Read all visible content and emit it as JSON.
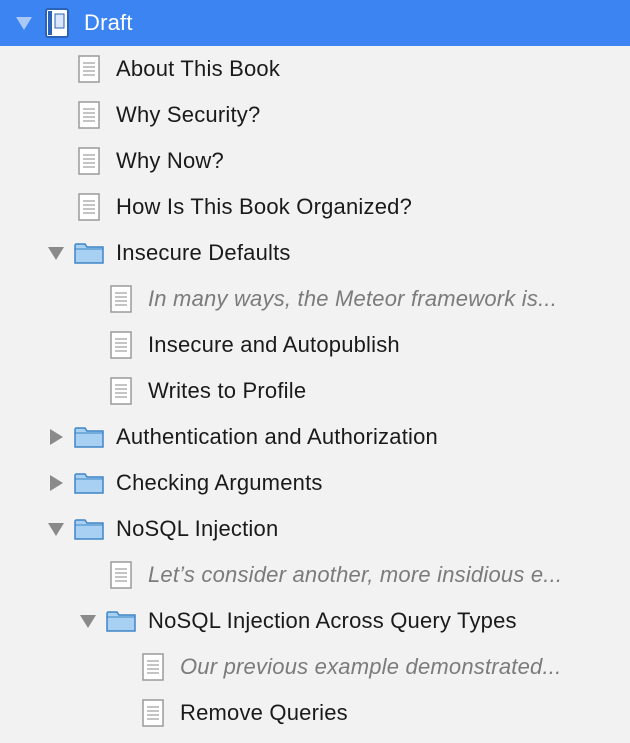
{
  "binder": {
    "items": [
      {
        "label": "Draft",
        "type": "book",
        "expanded": true,
        "selected": true,
        "italic": false
      },
      {
        "label": "About This Book",
        "type": "doc",
        "italic": false
      },
      {
        "label": "Why Security?",
        "type": "doc",
        "italic": false
      },
      {
        "label": "Why Now?",
        "type": "doc",
        "italic": false
      },
      {
        "label": "How Is This Book Organized?",
        "type": "doc",
        "italic": false
      },
      {
        "label": "Insecure Defaults",
        "type": "folder",
        "expanded": true,
        "italic": false
      },
      {
        "label": "In many ways, the Meteor framework is...",
        "type": "doc",
        "italic": true
      },
      {
        "label": "Insecure and Autopublish",
        "type": "doc",
        "italic": false
      },
      {
        "label": "Writes to Profile",
        "type": "doc",
        "italic": false
      },
      {
        "label": "Authentication and Authorization",
        "type": "folder",
        "expanded": false,
        "italic": false
      },
      {
        "label": "Checking Arguments",
        "type": "folder",
        "expanded": false,
        "italic": false
      },
      {
        "label": "NoSQL Injection",
        "type": "folder",
        "expanded": true,
        "italic": false
      },
      {
        "label": "Let’s consider another, more insidious e...",
        "type": "doc",
        "italic": true
      },
      {
        "label": "NoSQL Injection Across Query Types",
        "type": "folder",
        "expanded": true,
        "italic": false
      },
      {
        "label": "Our previous example demonstrated...",
        "type": "doc",
        "italic": true
      },
      {
        "label": "Remove Queries",
        "type": "doc",
        "italic": false
      }
    ]
  },
  "colors": {
    "selection": "#3b84f1",
    "folder_fill": "#a7d0f3",
    "folder_stroke": "#3f86c7",
    "synopsis_text": "#7b7b7b"
  }
}
